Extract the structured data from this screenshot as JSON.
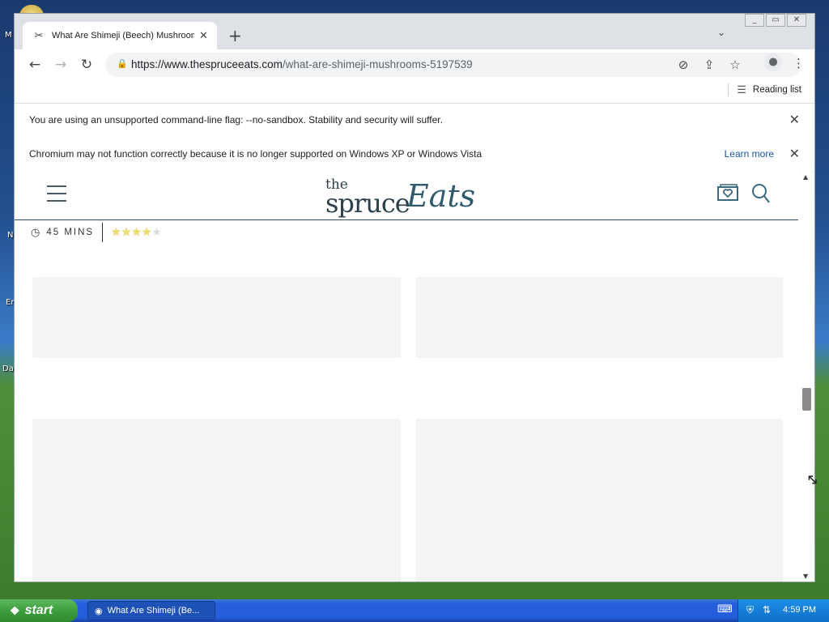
{
  "desktop": {
    "labels": [
      "M",
      "N",
      "Er",
      "Da"
    ]
  },
  "browser": {
    "tab": {
      "title": "What Are Shimeji (Beech) Mushroom",
      "favicon": "spoon-fork-icon"
    },
    "window_controls": [
      "minimize",
      "maximize",
      "close"
    ],
    "url_host": "https://www.thespruceeats.com",
    "url_path": "/what-are-shimeji-mushrooms-5197539",
    "reading_list_label": "Reading list",
    "infobars": [
      {
        "message": "You are using an unsupported command-line flag: --no-sandbox. Stability and security will suffer."
      },
      {
        "message": "Chromium may not function correctly because it is no longer supported on Windows XP or Windows Vista",
        "link": "Learn more"
      }
    ]
  },
  "page": {
    "logo": {
      "the": "the",
      "spruce": "spruce",
      "eats": "Eats"
    },
    "recipe_meta": {
      "time": "45 MINS",
      "rating": 4,
      "max_rating": 5
    }
  },
  "taskbar": {
    "start_label": "start",
    "task_label": "What Are Shimeji (Be...",
    "clock": "4:59 PM"
  },
  "colors": {
    "accent": "#2f5a6e",
    "link": "#1a55a8",
    "placeholder": "#f3f4f6"
  }
}
